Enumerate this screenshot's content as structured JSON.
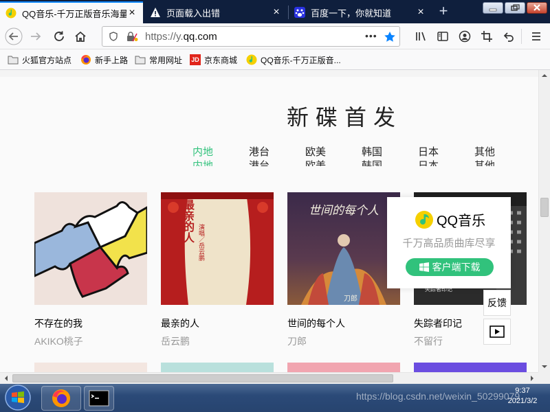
{
  "browser": {
    "tabs": [
      {
        "title": "QQ音乐-千万正版音乐海量无损",
        "icon": "qq-music-icon",
        "active": true
      },
      {
        "title": "页面载入出错",
        "icon": "warning-icon",
        "active": false
      },
      {
        "title": "百度一下，你就知道",
        "icon": "baidu-icon",
        "active": false
      }
    ],
    "new_tab_label": "+",
    "url_prefix": "https://y.",
    "url_domain": "qq.com",
    "url_more": "•••",
    "bookmarks": [
      {
        "label": "火狐官方站点",
        "icon": "folder-icon"
      },
      {
        "label": "新手上路",
        "icon": "firefox-icon"
      },
      {
        "label": "常用网址",
        "icon": "folder-icon"
      },
      {
        "label": "京东商城",
        "icon": "jd-icon",
        "icon_text": "JD"
      },
      {
        "label": "QQ音乐-千万正版音...",
        "icon": "qq-music-icon"
      }
    ]
  },
  "page": {
    "section_title": "新碟首发",
    "categories": [
      {
        "label": "内地",
        "active": true
      },
      {
        "label": "港台",
        "active": false
      },
      {
        "label": "欧美",
        "active": false
      },
      {
        "label": "韩国",
        "active": false
      },
      {
        "label": "日本",
        "active": false
      },
      {
        "label": "其他",
        "active": false
      }
    ],
    "albums": [
      {
        "name": "不存在的我",
        "artist": "AKIKO桃子"
      },
      {
        "name": "最亲的人",
        "artist": "岳云鹏"
      },
      {
        "name": "世间的每个人",
        "artist": "刀郎"
      },
      {
        "name": "失踪者印记",
        "artist": "不留行"
      }
    ],
    "cover_text": {
      "album2_title": "最亲的人",
      "album2_sub": "演唱／岳云鹏",
      "album3_title": "世间的每个人",
      "album3_sub": "刀郎",
      "album4_title": "失踪者印记"
    },
    "popup": {
      "brand": "QQ音乐",
      "slogan": "千万高品质曲库尽享",
      "button": "客户端下载"
    },
    "feedback_label": "反馈"
  },
  "taskbar": {
    "time": "9:37",
    "date": "2021/3/2",
    "watermark": "https://blog.csdn.net/weixin_50299079"
  },
  "colors": {
    "accent_green": "#31c27c",
    "tab_strip": "#0f1f3d",
    "firefox_blue": "#0a84ff"
  }
}
